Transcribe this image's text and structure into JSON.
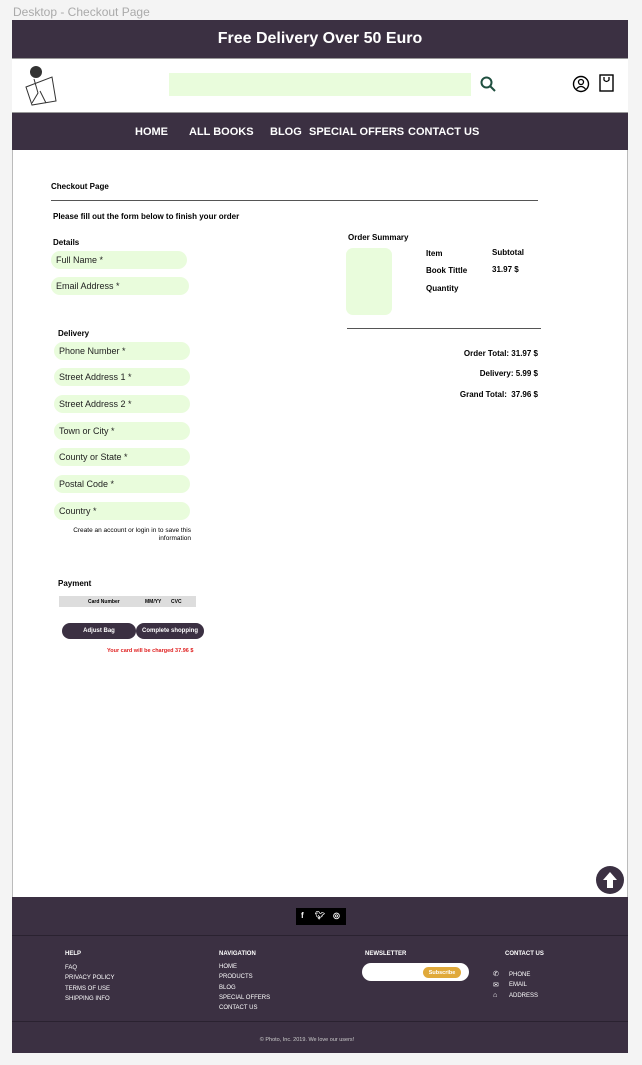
{
  "frame_title": "Desktop - Checkout Page",
  "banner": "Free Delivery Over 50 Euro",
  "header": {
    "search_placeholder": "",
    "search_icon": "search-icon",
    "account_icon": "user-icon",
    "bag_icon": "shopping-bag-icon"
  },
  "nav": [
    "HOME",
    "ALL BOOKS",
    "BLOG",
    "SPECIAL OFFERS",
    "CONTACT US"
  ],
  "page": {
    "title": "Checkout Page",
    "instructions": "Please fill out the form below to finish your order"
  },
  "details": {
    "heading": "Details",
    "fields": [
      "Full Name *",
      "Email Address *"
    ]
  },
  "delivery": {
    "heading": "Delivery",
    "fields": [
      "Phone Number *",
      "Street Address 1 *",
      "Street Address 2 *",
      "Town or City *",
      "County or State *",
      "Postal Code *",
      "Country *"
    ],
    "account_note": "Create an account or login in to save this information"
  },
  "payment": {
    "heading": "Payment",
    "card_number": "Card Number",
    "expiry": "MM/YY",
    "cvc": "CVC",
    "adjust_bag": "Adjust Bag",
    "complete": "Complete shopping",
    "charge_note": "Your card will be charged 37.96 $"
  },
  "summary": {
    "heading": "Order Summary",
    "item_label": "Item",
    "subtotal_label": "Subtotal",
    "book_title": "Book Tittle",
    "price": "31.97 $",
    "quantity_label": "Quantity",
    "order_total": "Order Total: 31.97 $",
    "delivery": "Delivery: 5.99 $",
    "grand_total": "Grand Total:  37.96 $"
  },
  "footer": {
    "help": {
      "heading": "HELP",
      "items": [
        "FAQ",
        "PRIVACY POLICY",
        "TERMS OF USE",
        "SHIPPING INFO"
      ]
    },
    "navigation": {
      "heading": "NAVIGATION",
      "items": [
        "HOME",
        "PRODUCTS",
        "BLOG",
        "SPECIAL OFFERS",
        "CONTACT US"
      ]
    },
    "newsletter": {
      "heading": "NEWSLETTER",
      "subscribe": "Subscribe"
    },
    "contact": {
      "heading": "CONTACT US",
      "items": [
        "PHONE",
        "EMAIL",
        "ADDRESS"
      ]
    },
    "copyright": "© Photo, Inc. 2019. We love our users!"
  },
  "colors": {
    "brand": "#3b3042",
    "input_bg": "#e9fcdc",
    "accent": "#e0a93a",
    "alert": "#e02020"
  }
}
